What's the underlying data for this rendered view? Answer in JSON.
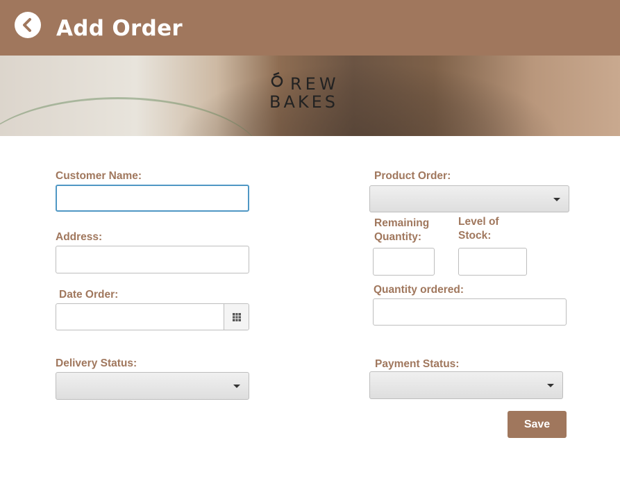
{
  "header": {
    "title": "Add Order",
    "back_icon": "chevron-left-icon"
  },
  "banner": {
    "brand_line1": "REW",
    "brand_line2": "BAKES"
  },
  "form": {
    "customer_name": {
      "label": "Customer Name:",
      "value": ""
    },
    "address": {
      "label": "Address:",
      "value": ""
    },
    "date_order": {
      "label": "Date Order:",
      "value": "",
      "icon": "calendar-icon"
    },
    "delivery_status": {
      "label": "Delivery Status:",
      "value": ""
    },
    "product_order": {
      "label": "Product Order:",
      "value": ""
    },
    "remaining_quantity": {
      "label_line1": "Remaining",
      "label_line2": "Quantity:",
      "value": ""
    },
    "level_of_stock": {
      "label_line1": "Level of",
      "label_line2": "Stock:",
      "value": ""
    },
    "quantity_ordered": {
      "label": "Quantity ordered:",
      "value": ""
    },
    "payment_status": {
      "label": "Payment Status:",
      "value": ""
    }
  },
  "actions": {
    "save_label": "Save"
  },
  "colors": {
    "header": "#a0775d",
    "label": "#a0775d",
    "focus_border": "#4f97c4",
    "button": "#a0775d"
  }
}
